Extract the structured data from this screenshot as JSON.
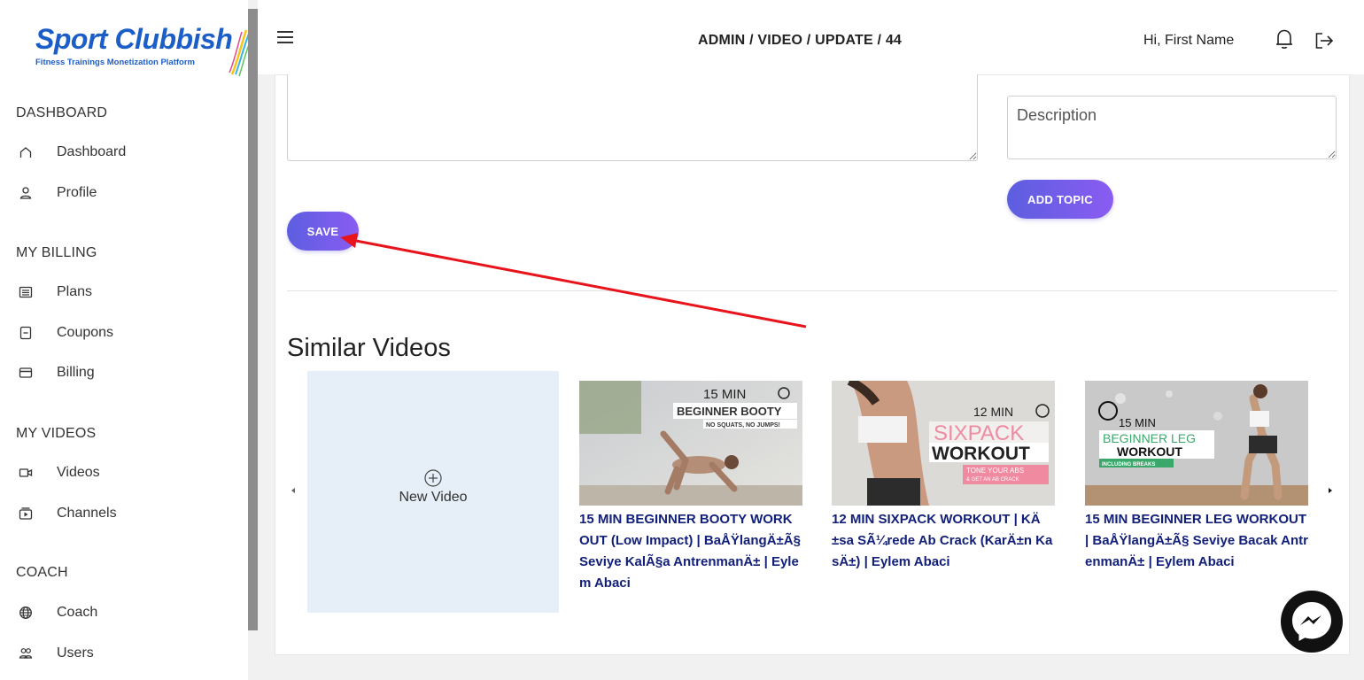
{
  "brand": {
    "title": "Sport Clubbish",
    "subtitle": "Fitness Trainings Monetization Platform"
  },
  "sidebar": {
    "sections": [
      {
        "label": "DASHBOARD"
      },
      {
        "label": "MY BILLING"
      },
      {
        "label": "MY VIDEOS"
      },
      {
        "label": "COACH"
      }
    ],
    "items": [
      {
        "label": "Dashboard",
        "icon": "home-icon"
      },
      {
        "label": "Profile",
        "icon": "user-icon"
      },
      {
        "label": "Plans",
        "icon": "list-icon"
      },
      {
        "label": "Coupons",
        "icon": "coupon-icon"
      },
      {
        "label": "Billing",
        "icon": "credit-card-icon"
      },
      {
        "label": "Videos",
        "icon": "video-camera-icon"
      },
      {
        "label": "Channels",
        "icon": "channel-icon"
      },
      {
        "label": "Coach",
        "icon": "globe-icon"
      },
      {
        "label": "Users",
        "icon": "users-icon"
      }
    ]
  },
  "header": {
    "breadcrumb": "ADMIN / VIDEO / UPDATE / 44",
    "greeting": "Hi, First Name"
  },
  "form": {
    "description_placeholder": "Description",
    "save_label": "SAVE",
    "add_topic_label": "ADD TOPIC"
  },
  "similar": {
    "title": "Similar Videos",
    "new_video_label": "New Video",
    "videos": [
      {
        "title": "15 MIN BEGINNER BOOTY WORKOUT (Low Impact) | BaÅŸlangÄ±Ã§ Seviye KalÃ§a AntrenmanÄ± | Eylem Abaci",
        "thumb_lines": [
          "15 MIN",
          "BEGINNER BOOTY",
          "NO SQUATS, NO JUMPS!"
        ]
      },
      {
        "title": "12 MIN SIXPACK WORKOUT | KÄ±sa SÃ¼rede Ab Crack (KarÄ±n KasÄ±) | Eylem Abaci",
        "thumb_lines": [
          "12 MIN",
          "SIXPACK",
          "WORKOUT",
          "TONE YOUR ABS",
          "& GET AN AB CRACK"
        ]
      },
      {
        "title": "15 MIN BEGINNER LEG WORKOUT | BaÅŸlangÄ±Ã§ Seviye Bacak AntrenmanÄ± | Eylem Abaci",
        "thumb_lines": [
          "15 MIN",
          "BEGINNER LEG",
          "WORKOUT",
          "INCLUDING BREAKS"
        ]
      }
    ]
  },
  "colors": {
    "brand_blue": "#1c5ec7",
    "button_gradient_start": "#5c5ee0",
    "button_gradient_end": "#8a5cf2",
    "video_title": "#13207a",
    "annotation_arrow": "#e8141b"
  }
}
